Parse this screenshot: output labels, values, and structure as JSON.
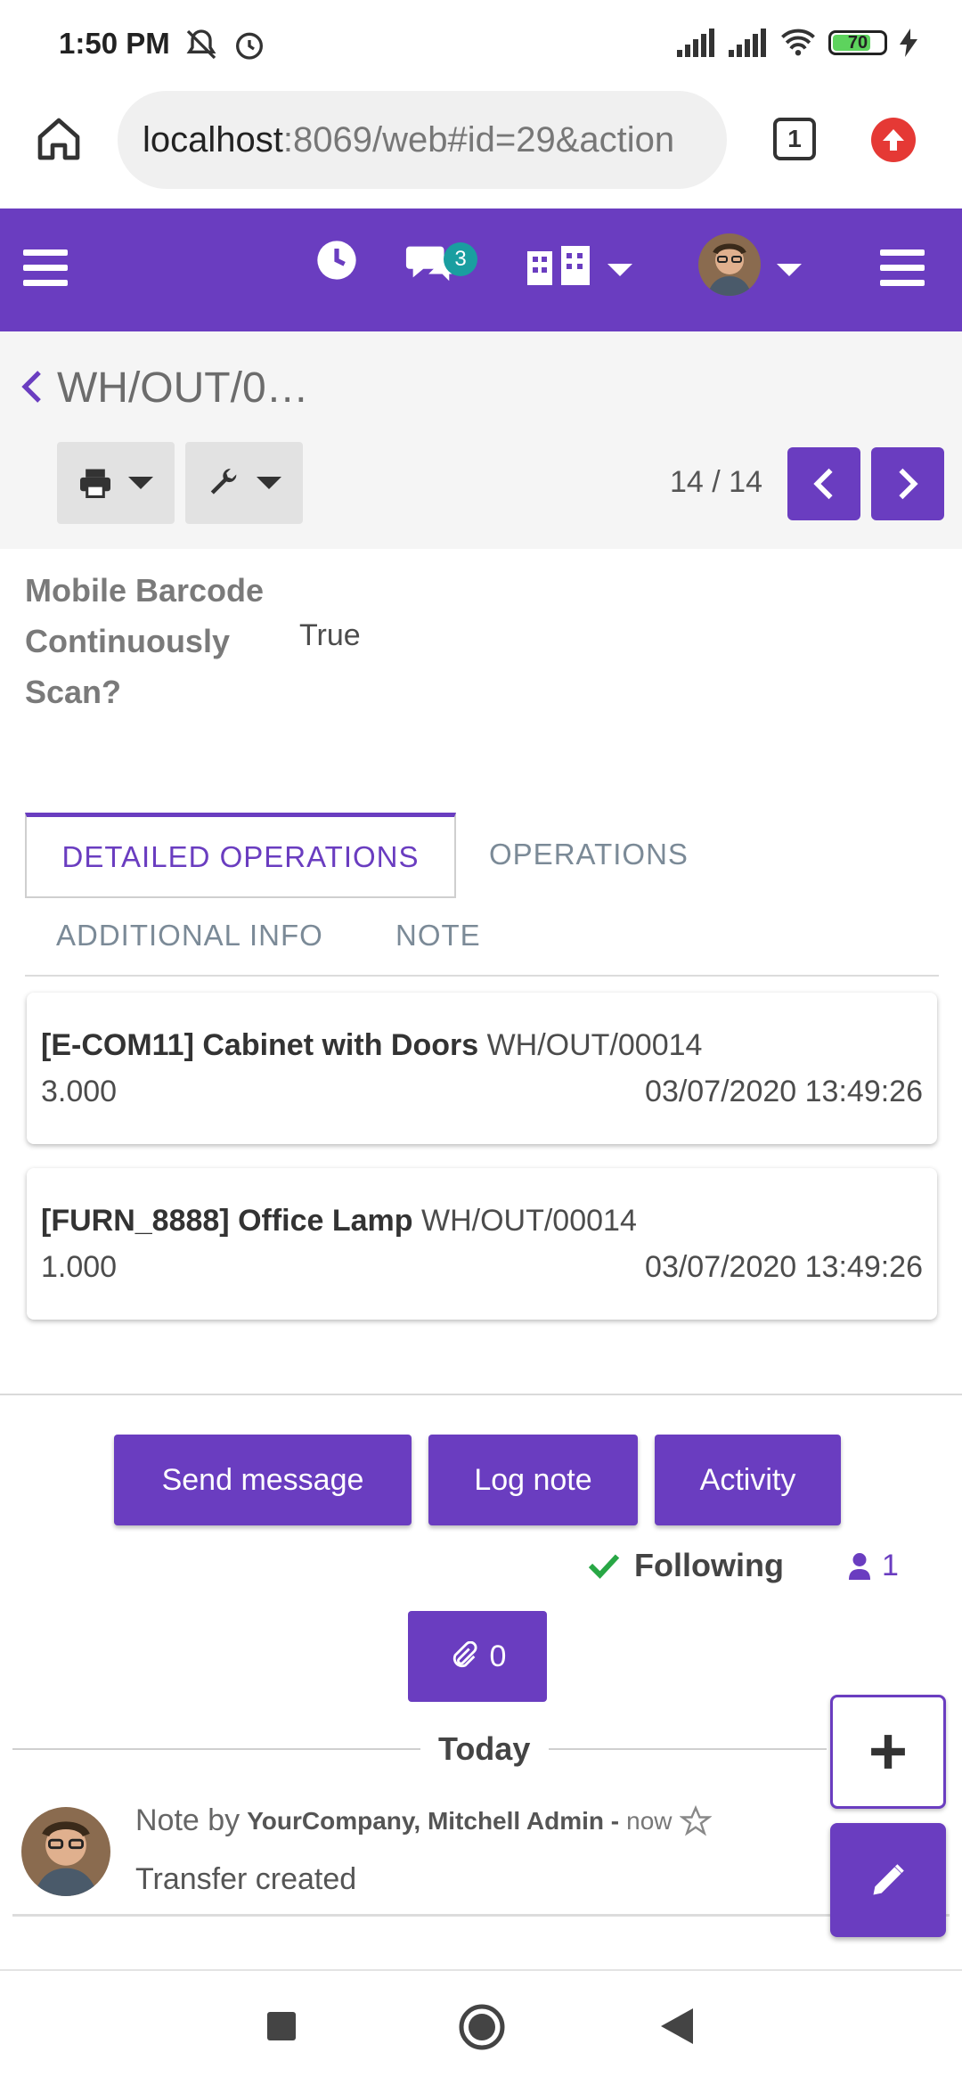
{
  "status_bar": {
    "time": "1:50 PM",
    "battery_level": "70"
  },
  "browser": {
    "url_host": "localhost",
    "url_rest": ":8069/web#id=29&action",
    "tab_count": "1"
  },
  "navbar": {
    "message_badge": "3"
  },
  "control_panel": {
    "breadcrumb": "WH/OUT/0…",
    "pager_value": "14 / 14"
  },
  "form": {
    "field_label": "Mobile Barcode Continuously Scan?",
    "field_value": "True"
  },
  "tabs": [
    {
      "label": "DETAILED OPERATIONS"
    },
    {
      "label": "OPERATIONS"
    },
    {
      "label": "ADDITIONAL INFO"
    },
    {
      "label": "NOTE"
    }
  ],
  "operations": [
    {
      "product": "[E-COM11] Cabinet with Doors",
      "reference": "WH/OUT/00014",
      "quantity": "3.000",
      "date": "03/07/2020 13:49:26"
    },
    {
      "product": "[FURN_8888] Office Lamp",
      "reference": "WH/OUT/00014",
      "quantity": "1.000",
      "date": "03/07/2020 13:49:26"
    }
  ],
  "chatter": {
    "send_message": "Send message",
    "log_note": "Log note",
    "activity": "Activity",
    "following": "Following",
    "followers_count": "1",
    "attachments_count": "0",
    "date_separator": "Today",
    "message": {
      "prefix": "Note by",
      "author": "YourCompany, Mitchell Admin -",
      "time": "now",
      "body": "Transfer created"
    }
  },
  "colors": {
    "brand": "#6a3dc0",
    "badge": "#1a9ea0",
    "following_check": "#28a745"
  }
}
